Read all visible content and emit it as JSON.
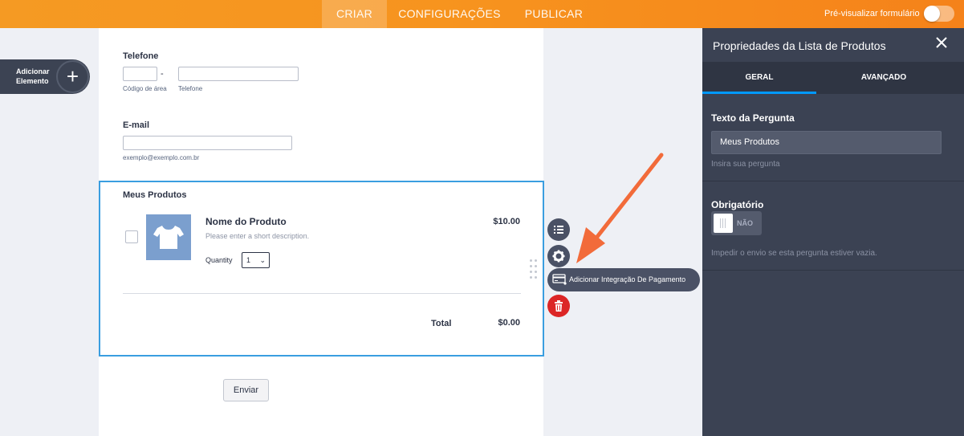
{
  "topbar": {
    "tabs": [
      {
        "label": "CRIAR",
        "active": true
      },
      {
        "label": "CONFIGURAÇÕES",
        "active": false
      },
      {
        "label": "PUBLICAR",
        "active": false
      }
    ],
    "preview_label": "Pré-visualizar formulário",
    "preview_toggle_on": false
  },
  "add_element": {
    "label": "Adicionar Elemento",
    "icon": "plus-icon"
  },
  "form": {
    "phone": {
      "label": "Telefone",
      "separator": "-",
      "area_code_sublabel": "Código de área",
      "phone_sublabel": "Telefone"
    },
    "email": {
      "label": "E-mail",
      "sublabel": "exemplo@exemplo.com.br"
    },
    "products": {
      "label": "Meus Produtos",
      "item": {
        "name": "Nome do Produto",
        "description": "Please enter a short description.",
        "price": "$10.00",
        "quantity_label": "Quantity",
        "quantity_value": "1",
        "image_icon": "tshirt-icon"
      },
      "total_label": "Total",
      "total_value": "$0.00"
    },
    "submit_label": "Enviar"
  },
  "tools": {
    "payment_label": "Adicionar Integração De Pagamento",
    "icons": [
      "list-icon",
      "gear-icon",
      "credit-card-icon",
      "trash-icon"
    ]
  },
  "panel": {
    "title": "Propriedades da Lista de Produtos",
    "tabs": [
      {
        "label": "GERAL",
        "active": true
      },
      {
        "label": "AVANÇADO",
        "active": false
      }
    ],
    "question": {
      "title": "Texto da Pergunta",
      "value": "Meus Produtos",
      "help": "Insira sua pergunta"
    },
    "required": {
      "title": "Obrigatório",
      "switch_label": "NÃO",
      "help": "Impedir o envio se esta pergunta estiver vazia."
    }
  },
  "colors": {
    "accent": "#f7931e",
    "selection": "#3a9ee0",
    "panel": "#3b4253",
    "annotation_arrow": "#f26b3a",
    "delete": "#dc2626"
  }
}
